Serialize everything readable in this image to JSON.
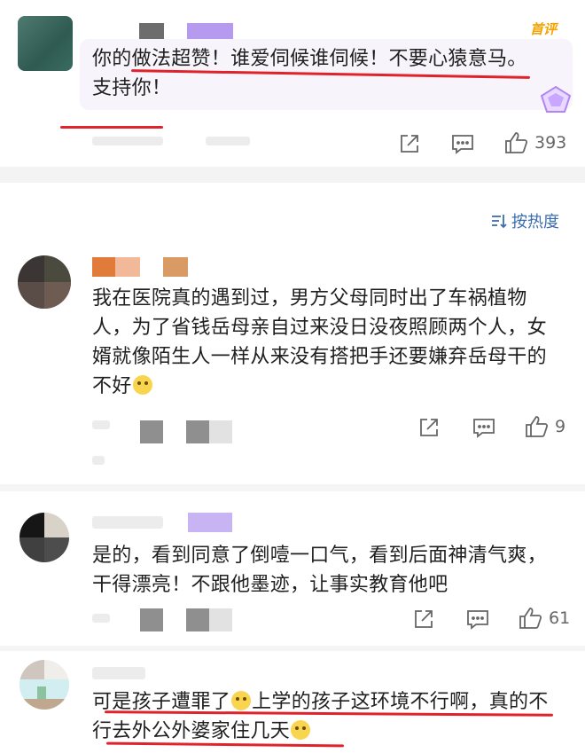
{
  "top_comment": {
    "badge": "首评",
    "text_line1": "你的做法超赞！谁爱伺候谁伺候！不要心猿意马。",
    "text_line2": "支持你！",
    "likes": "393",
    "colors": {
      "badge": "#f5a300",
      "highlight": "#e0222b",
      "bubble": "#f7f5fb"
    }
  },
  "sort": {
    "label": "按热度",
    "icon": "sort-icon"
  },
  "comments": [
    {
      "text": "我在医院真的遇到过，男方父母同时出了车祸植物人，为了省钱岳母亲自过来没日没夜照顾两个人，女婿就像陌生人一样从来没有搭把手还要嫌弃岳母干的不好",
      "emoji": "smile-emoji",
      "likes": "9"
    },
    {
      "text": "是的，看到同意了倒噎一口气，看到后面神清气爽，干得漂亮！不跟他墨迹，让事实教育他吧",
      "likes": "61"
    },
    {
      "text_part1": "可是孩子遭罪了",
      "emoji": "worried-emoji",
      "text_part2": "上学的孩子这环境不行啊，真的不行去外公外婆家住几天",
      "emoji2": "laugh-emoji"
    }
  ]
}
